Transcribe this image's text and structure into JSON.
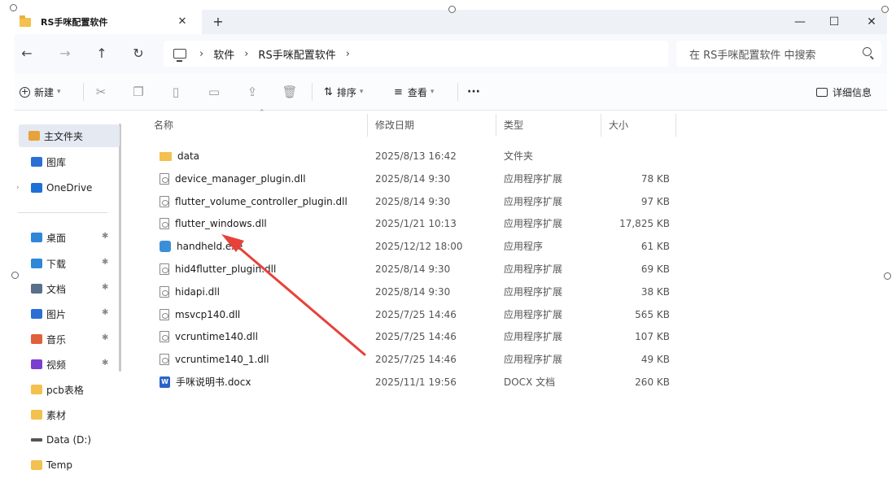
{
  "window": {
    "tab_title": "RS手咪配置软件",
    "tab_close": "✕",
    "new_tab": "+",
    "minimize": "—",
    "maximize": "☐",
    "close": "✕"
  },
  "nav": {
    "back": "←",
    "forward": "→",
    "up": "↑",
    "refresh": "↻",
    "breadcrumb": [
      "软件",
      "RS手咪配置软件"
    ],
    "crumb_sep": "›",
    "search_placeholder": "在 RS手咪配置软件 中搜索"
  },
  "toolbar": {
    "new_label": "新建",
    "sort_label": "排序",
    "view_label": "查看",
    "more": "···",
    "details_label": "详细信息"
  },
  "sidebar": {
    "items": [
      {
        "label": "主文件夹",
        "icon": "home-icon",
        "color": "#e8a23a"
      },
      {
        "label": "图库",
        "icon": "gallery-icon",
        "color": "#2a6fd6"
      },
      {
        "label": "OneDrive",
        "icon": "cloud-icon",
        "color": "#1f6fd8"
      },
      {
        "label": "桌面",
        "icon": "desktop-icon",
        "color": "#2f87d8",
        "pinned": true
      },
      {
        "label": "下载",
        "icon": "download-icon",
        "color": "#2f87d8",
        "pinned": true
      },
      {
        "label": "文档",
        "icon": "document-icon",
        "color": "#5a6f8c",
        "pinned": true
      },
      {
        "label": "图片",
        "icon": "pictures-icon",
        "color": "#2a6fd6",
        "pinned": true
      },
      {
        "label": "音乐",
        "icon": "music-icon",
        "color": "#e0603a",
        "pinned": true
      },
      {
        "label": "视频",
        "icon": "video-icon",
        "color": "#7a3fd0",
        "pinned": true
      },
      {
        "label": "pcb表格",
        "icon": "folder-icon",
        "color": "#f2c14e"
      },
      {
        "label": "素材",
        "icon": "folder-icon",
        "color": "#f2c14e"
      },
      {
        "label": "Data (D:)",
        "icon": "drive-icon",
        "color": "#555555"
      },
      {
        "label": "Temp",
        "icon": "folder-icon",
        "color": "#f2c14e"
      }
    ],
    "pin_glyph": "✱"
  },
  "columns": {
    "name": "名称",
    "date": "修改日期",
    "type": "类型",
    "size": "大小"
  },
  "files": [
    {
      "name": "data",
      "date": "2025/8/13 16:42",
      "type": "文件夹",
      "size": "",
      "kind": "folder"
    },
    {
      "name": "device_manager_plugin.dll",
      "date": "2025/8/14 9:30",
      "type": "应用程序扩展",
      "size": "78 KB",
      "kind": "dll"
    },
    {
      "name": "flutter_volume_controller_plugin.dll",
      "date": "2025/8/14 9:30",
      "type": "应用程序扩展",
      "size": "97 KB",
      "kind": "dll"
    },
    {
      "name": "flutter_windows.dll",
      "date": "2025/1/21 10:13",
      "type": "应用程序扩展",
      "size": "17,825 KB",
      "kind": "dll"
    },
    {
      "name": "handheld.exe",
      "date": "2025/12/12 18:00",
      "type": "应用程序",
      "size": "61 KB",
      "kind": "exe"
    },
    {
      "name": "hid4flutter_plugin.dll",
      "date": "2025/8/14 9:30",
      "type": "应用程序扩展",
      "size": "69 KB",
      "kind": "dll"
    },
    {
      "name": "hidapi.dll",
      "date": "2025/8/14 9:30",
      "type": "应用程序扩展",
      "size": "38 KB",
      "kind": "dll"
    },
    {
      "name": "msvcp140.dll",
      "date": "2025/7/25 14:46",
      "type": "应用程序扩展",
      "size": "565 KB",
      "kind": "dll"
    },
    {
      "name": "vcruntime140.dll",
      "date": "2025/7/25 14:46",
      "type": "应用程序扩展",
      "size": "107 KB",
      "kind": "dll"
    },
    {
      "name": "vcruntime140_1.dll",
      "date": "2025/7/25 14:46",
      "type": "应用程序扩展",
      "size": "49 KB",
      "kind": "dll"
    },
    {
      "name": "手咪说明书.docx",
      "date": "2025/11/1 19:56",
      "type": "DOCX 文档",
      "size": "260 KB",
      "kind": "docx"
    }
  ],
  "annotation": {
    "color": "#e8413a"
  }
}
